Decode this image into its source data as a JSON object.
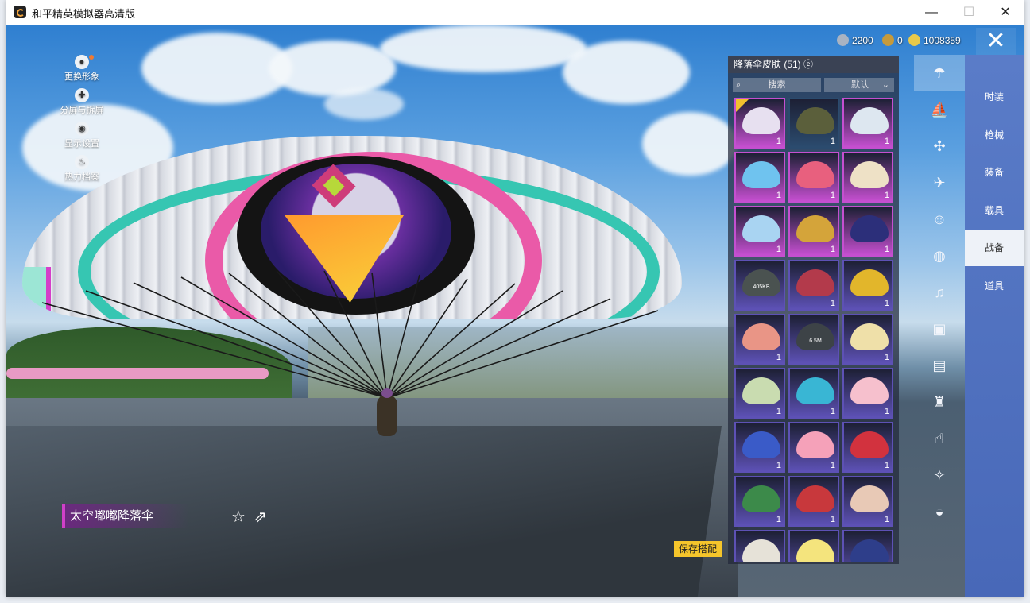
{
  "window": {
    "title": "和平精英模拟器高清版",
    "controls": [
      "—",
      "☐",
      "✕"
    ]
  },
  "side_menu": [
    {
      "label": "更换形象",
      "icon": "person-icon",
      "glyph": "●"
    },
    {
      "label": "分屏与拆屏",
      "icon": "split-screen-icon",
      "glyph": "✚"
    },
    {
      "label": "显示设置",
      "icon": "eye-icon",
      "glyph": "◉"
    },
    {
      "label": "热力档案",
      "icon": "flame-icon",
      "glyph": "♨"
    }
  ],
  "currency": [
    {
      "value": "2200",
      "icon": "silver-coin-icon",
      "color": "#a9b3c2"
    },
    {
      "value": "0",
      "icon": "gold-badge-icon",
      "color": "#c69a3b"
    },
    {
      "value": "1008359",
      "icon": "gold-coin-icon",
      "color": "#e9c94a"
    }
  ],
  "panel": {
    "title": "降落伞皮肤 (51)",
    "search_label": "搜索",
    "sort_label": "默认",
    "items": [
      {
        "rarity": "#c54fd0",
        "color": "#e7e0f0",
        "count": "1",
        "selected": true
      },
      {
        "rarity": "#2b4b6e",
        "color": "#5b5f3b",
        "count": "1"
      },
      {
        "rarity": "#c54fd0",
        "color": "#dde7f0",
        "count": "1"
      },
      {
        "rarity": "#c54fd0",
        "color": "#6fc3ef",
        "count": "1"
      },
      {
        "rarity": "#c54fd0",
        "color": "#e8607e",
        "count": "1"
      },
      {
        "rarity": "#c54fd0",
        "color": "#eee1c6",
        "count": "1"
      },
      {
        "rarity": "#c54fd0",
        "color": "#a9d4f2",
        "count": "1"
      },
      {
        "rarity": "#c54fd0",
        "color": "#d4a43a",
        "count": "1"
      },
      {
        "rarity": "#c54fd0",
        "color": "#2c2f7a",
        "count": "1"
      },
      {
        "rarity": "#5d51b5",
        "color": "#4a5250",
        "count": "",
        "size": "405KB"
      },
      {
        "rarity": "#5d51b5",
        "color": "#b33a4b",
        "count": "1"
      },
      {
        "rarity": "#5d51b5",
        "color": "#e2b62b",
        "count": "1"
      },
      {
        "rarity": "#5d51b5",
        "color": "#e99586",
        "count": "1"
      },
      {
        "rarity": "#5d51b5",
        "color": "#3d4347",
        "count": "",
        "size": "6.5M"
      },
      {
        "rarity": "#5d51b5",
        "color": "#efe0a9",
        "count": "1"
      },
      {
        "rarity": "#5d51b5",
        "color": "#c9dcb0",
        "count": "1"
      },
      {
        "rarity": "#5d51b5",
        "color": "#39b6d4",
        "count": "1"
      },
      {
        "rarity": "#5d51b5",
        "color": "#f6c0cd",
        "count": "1"
      },
      {
        "rarity": "#5d51b5",
        "color": "#3a5bc8",
        "count": "1"
      },
      {
        "rarity": "#5d51b5",
        "color": "#f5a1b9",
        "count": "1"
      },
      {
        "rarity": "#5d51b5",
        "color": "#d2323e",
        "count": "1"
      },
      {
        "rarity": "#5d51b5",
        "color": "#3c8a4a",
        "count": "1"
      },
      {
        "rarity": "#5d51b5",
        "color": "#c8383c",
        "count": "1"
      },
      {
        "rarity": "#5d51b5",
        "color": "#e8c9b6",
        "count": "1"
      },
      {
        "rarity": "#5d51b5",
        "color": "#e6e2d8",
        "count": ""
      },
      {
        "rarity": "#5d51b5",
        "color": "#f4e47d",
        "count": ""
      },
      {
        "rarity": "#5d51b5",
        "color": "#2e3e8a",
        "count": ""
      }
    ]
  },
  "categories": [
    {
      "icon": "parachute-icon",
      "glyph": "☂",
      "active": true
    },
    {
      "icon": "boat-icon",
      "glyph": "⛵"
    },
    {
      "icon": "drone-icon",
      "glyph": "✣"
    },
    {
      "icon": "plane-icon",
      "glyph": "✈"
    },
    {
      "icon": "face-icon",
      "glyph": "☺"
    },
    {
      "icon": "robot-icon",
      "glyph": "◍"
    },
    {
      "icon": "speaker-icon",
      "glyph": "♫"
    },
    {
      "icon": "chat-icon",
      "glyph": "▣"
    },
    {
      "icon": "photo-icon",
      "glyph": "▤"
    },
    {
      "icon": "spray-icon",
      "glyph": "♜"
    },
    {
      "icon": "hand-icon",
      "glyph": "☝"
    },
    {
      "icon": "wand-icon",
      "glyph": "✧"
    },
    {
      "icon": "landing-icon",
      "glyph": "◒"
    }
  ],
  "tabs": [
    {
      "label": "时装",
      "active": false
    },
    {
      "label": "枪械",
      "active": false
    },
    {
      "label": "装备",
      "active": false
    },
    {
      "label": "载具",
      "active": false
    },
    {
      "label": "战备",
      "active": true
    },
    {
      "label": "道具",
      "active": false
    }
  ],
  "item_name": "太空嘟嘟降落伞",
  "save_label": "保存搭配",
  "close_icon": "✕"
}
